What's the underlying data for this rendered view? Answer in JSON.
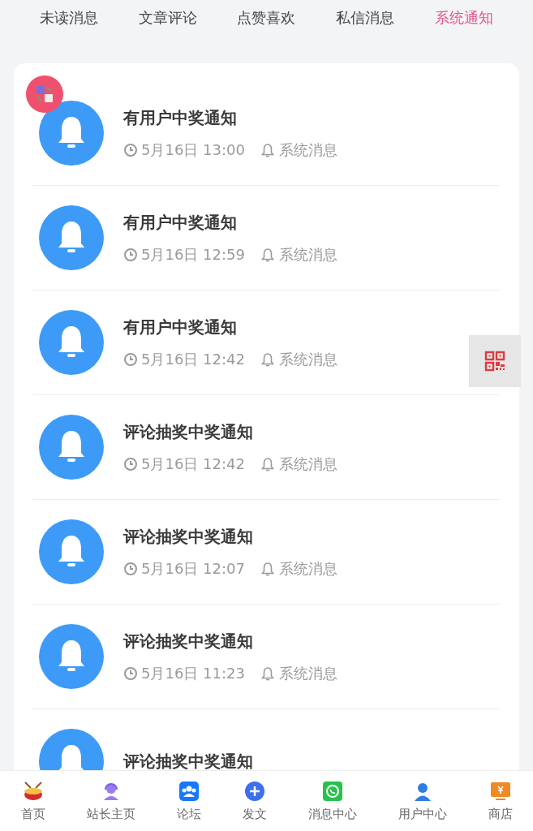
{
  "tabs": [
    {
      "label": "未读消息",
      "selected": false
    },
    {
      "label": "文章评论",
      "selected": false
    },
    {
      "label": "点赞喜欢",
      "selected": false
    },
    {
      "label": "私信消息",
      "selected": false
    },
    {
      "label": "系统通知",
      "selected": true
    }
  ],
  "notifications": [
    {
      "title": "有用户中奖通知",
      "time": "5月16日 13:00",
      "category": "系统消息"
    },
    {
      "title": "有用户中奖通知",
      "time": "5月16日 12:59",
      "category": "系统消息"
    },
    {
      "title": "有用户中奖通知",
      "time": "5月16日 12:42",
      "category": "系统消息"
    },
    {
      "title": "评论抽奖中奖通知",
      "time": "5月16日 12:42",
      "category": "系统消息"
    },
    {
      "title": "评论抽奖中奖通知",
      "time": "5月16日 12:07",
      "category": "系统消息"
    },
    {
      "title": "评论抽奖中奖通知",
      "time": "5月16日 11:23",
      "category": "系统消息"
    },
    {
      "title": "评论抽奖中奖通知"
    }
  ],
  "bottom_nav": [
    {
      "label": "首页",
      "kind": "drum"
    },
    {
      "label": "站长主页",
      "kind": "headset"
    },
    {
      "label": "论坛",
      "kind": "group"
    },
    {
      "label": "发文",
      "kind": "plus"
    },
    {
      "label": "消息中心",
      "kind": "chat"
    },
    {
      "label": "用户中心",
      "kind": "user"
    },
    {
      "label": "商店",
      "kind": "shop"
    }
  ]
}
